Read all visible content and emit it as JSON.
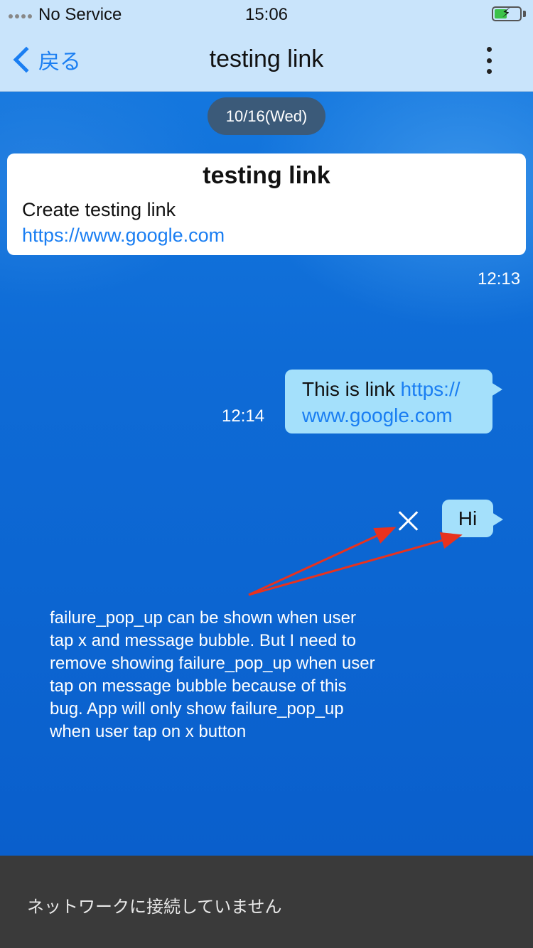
{
  "status_bar": {
    "carrier": "No Service",
    "time": "15:06",
    "battery_level": 0.5
  },
  "nav": {
    "back_label": "戻る",
    "title": "testing link"
  },
  "chat": {
    "date_label": "10/16(Wed)",
    "system_card": {
      "title": "testing link",
      "body": "Create testing link",
      "link": "https://www.google.com",
      "time": "12:13"
    },
    "messages": [
      {
        "text": "This is link ",
        "link_line1": "https://",
        "link_line2": "www.google.com",
        "time": "12:14"
      },
      {
        "text": "Hi",
        "status": "failed"
      }
    ]
  },
  "annotation": {
    "note": "failure_pop_up can be shown when user tap x and message bubble. But I need to remove showing failure_pop_up when user tap on message bubble because of this bug. App will only show failure_pop_up when user tap on x button",
    "arrow_color": "#e8321e"
  },
  "bottom_bar": {
    "message": "ネットワークに接続していません"
  },
  "colors": {
    "accent": "#1a7ef2",
    "bubble": "#a4e0fb",
    "nav_bg": "#c9e4fb"
  }
}
